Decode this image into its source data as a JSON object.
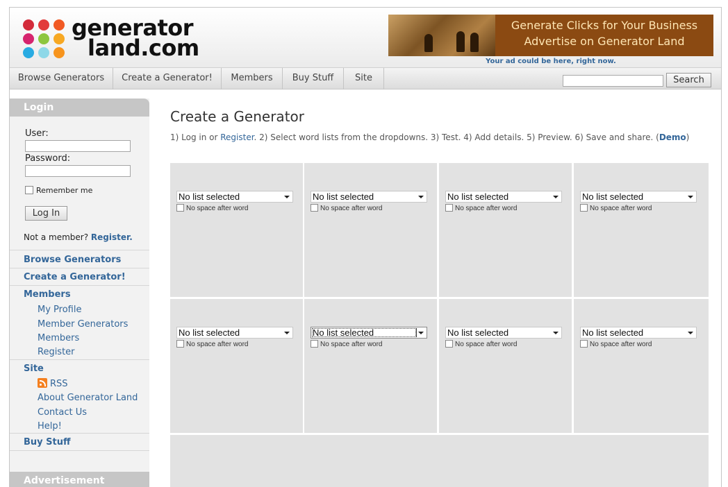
{
  "header": {
    "logo_line1": "generator",
    "logo_line2": "land.com",
    "ad_line1": "Generate Clicks for Your Business",
    "ad_line2": "Advertise on Generator Land",
    "ad_note": "Your ad could be here, right now."
  },
  "nav": {
    "items": [
      "Browse Generators",
      "Create a Generator!",
      "Members",
      "Buy Stuff",
      "Site"
    ],
    "search_button": "Search",
    "search_value": ""
  },
  "sidebar": {
    "login_heading": "Login",
    "user_label": "User:",
    "password_label": "Password:",
    "remember_label": "Remember me",
    "login_button": "Log In",
    "not_member_text": "Not a member?",
    "register_link": "Register.",
    "browse": "Browse Generators",
    "create": "Create a Generator!",
    "members": "Members",
    "members_items": [
      "My Profile",
      "Member Generators",
      "Members",
      "Register"
    ],
    "site": "Site",
    "site_items": [
      "RSS",
      "About Generator Land",
      "Contact Us",
      "Help!"
    ],
    "buy": "Buy Stuff",
    "ad_heading": "Advertisement"
  },
  "main": {
    "title": "Create a Generator",
    "steps_pre": "1) Log in or ",
    "steps_register": "Register",
    "steps_post": ". 2) Select word lists from the dropdowns. 3) Test. 4) Add details. 5) Preview. 6) Save and share. (",
    "steps_demo": "Demo",
    "steps_end": ")",
    "cells": [
      {
        "select": "No list selected",
        "checkbox": "No space after word"
      },
      {
        "select": "No list selected",
        "checkbox": "No space after word"
      },
      {
        "select": "No list selected",
        "checkbox": "No space after word"
      },
      {
        "select": "No list selected",
        "checkbox": "No space after word"
      },
      {
        "select": "No list selected",
        "checkbox": "No space after word"
      },
      {
        "select": "No list selected",
        "checkbox": "No space after word"
      },
      {
        "select": "No list selected",
        "checkbox": "No space after word"
      },
      {
        "select": "No list selected",
        "checkbox": "No space after word"
      }
    ]
  },
  "colors": {
    "link": "#336699",
    "sidebar_heading": "#c6c6c6",
    "cell_bg": "#e2e2e2",
    "ad_bg": "#8b4a12",
    "logo_dots": [
      "#d32b3a",
      "#8dc63f",
      "#f7941d",
      "#f15a24",
      "#8dc63f",
      "#f7941d",
      "#29abe2",
      "#8ed8e8",
      "#f7a823"
    ]
  }
}
